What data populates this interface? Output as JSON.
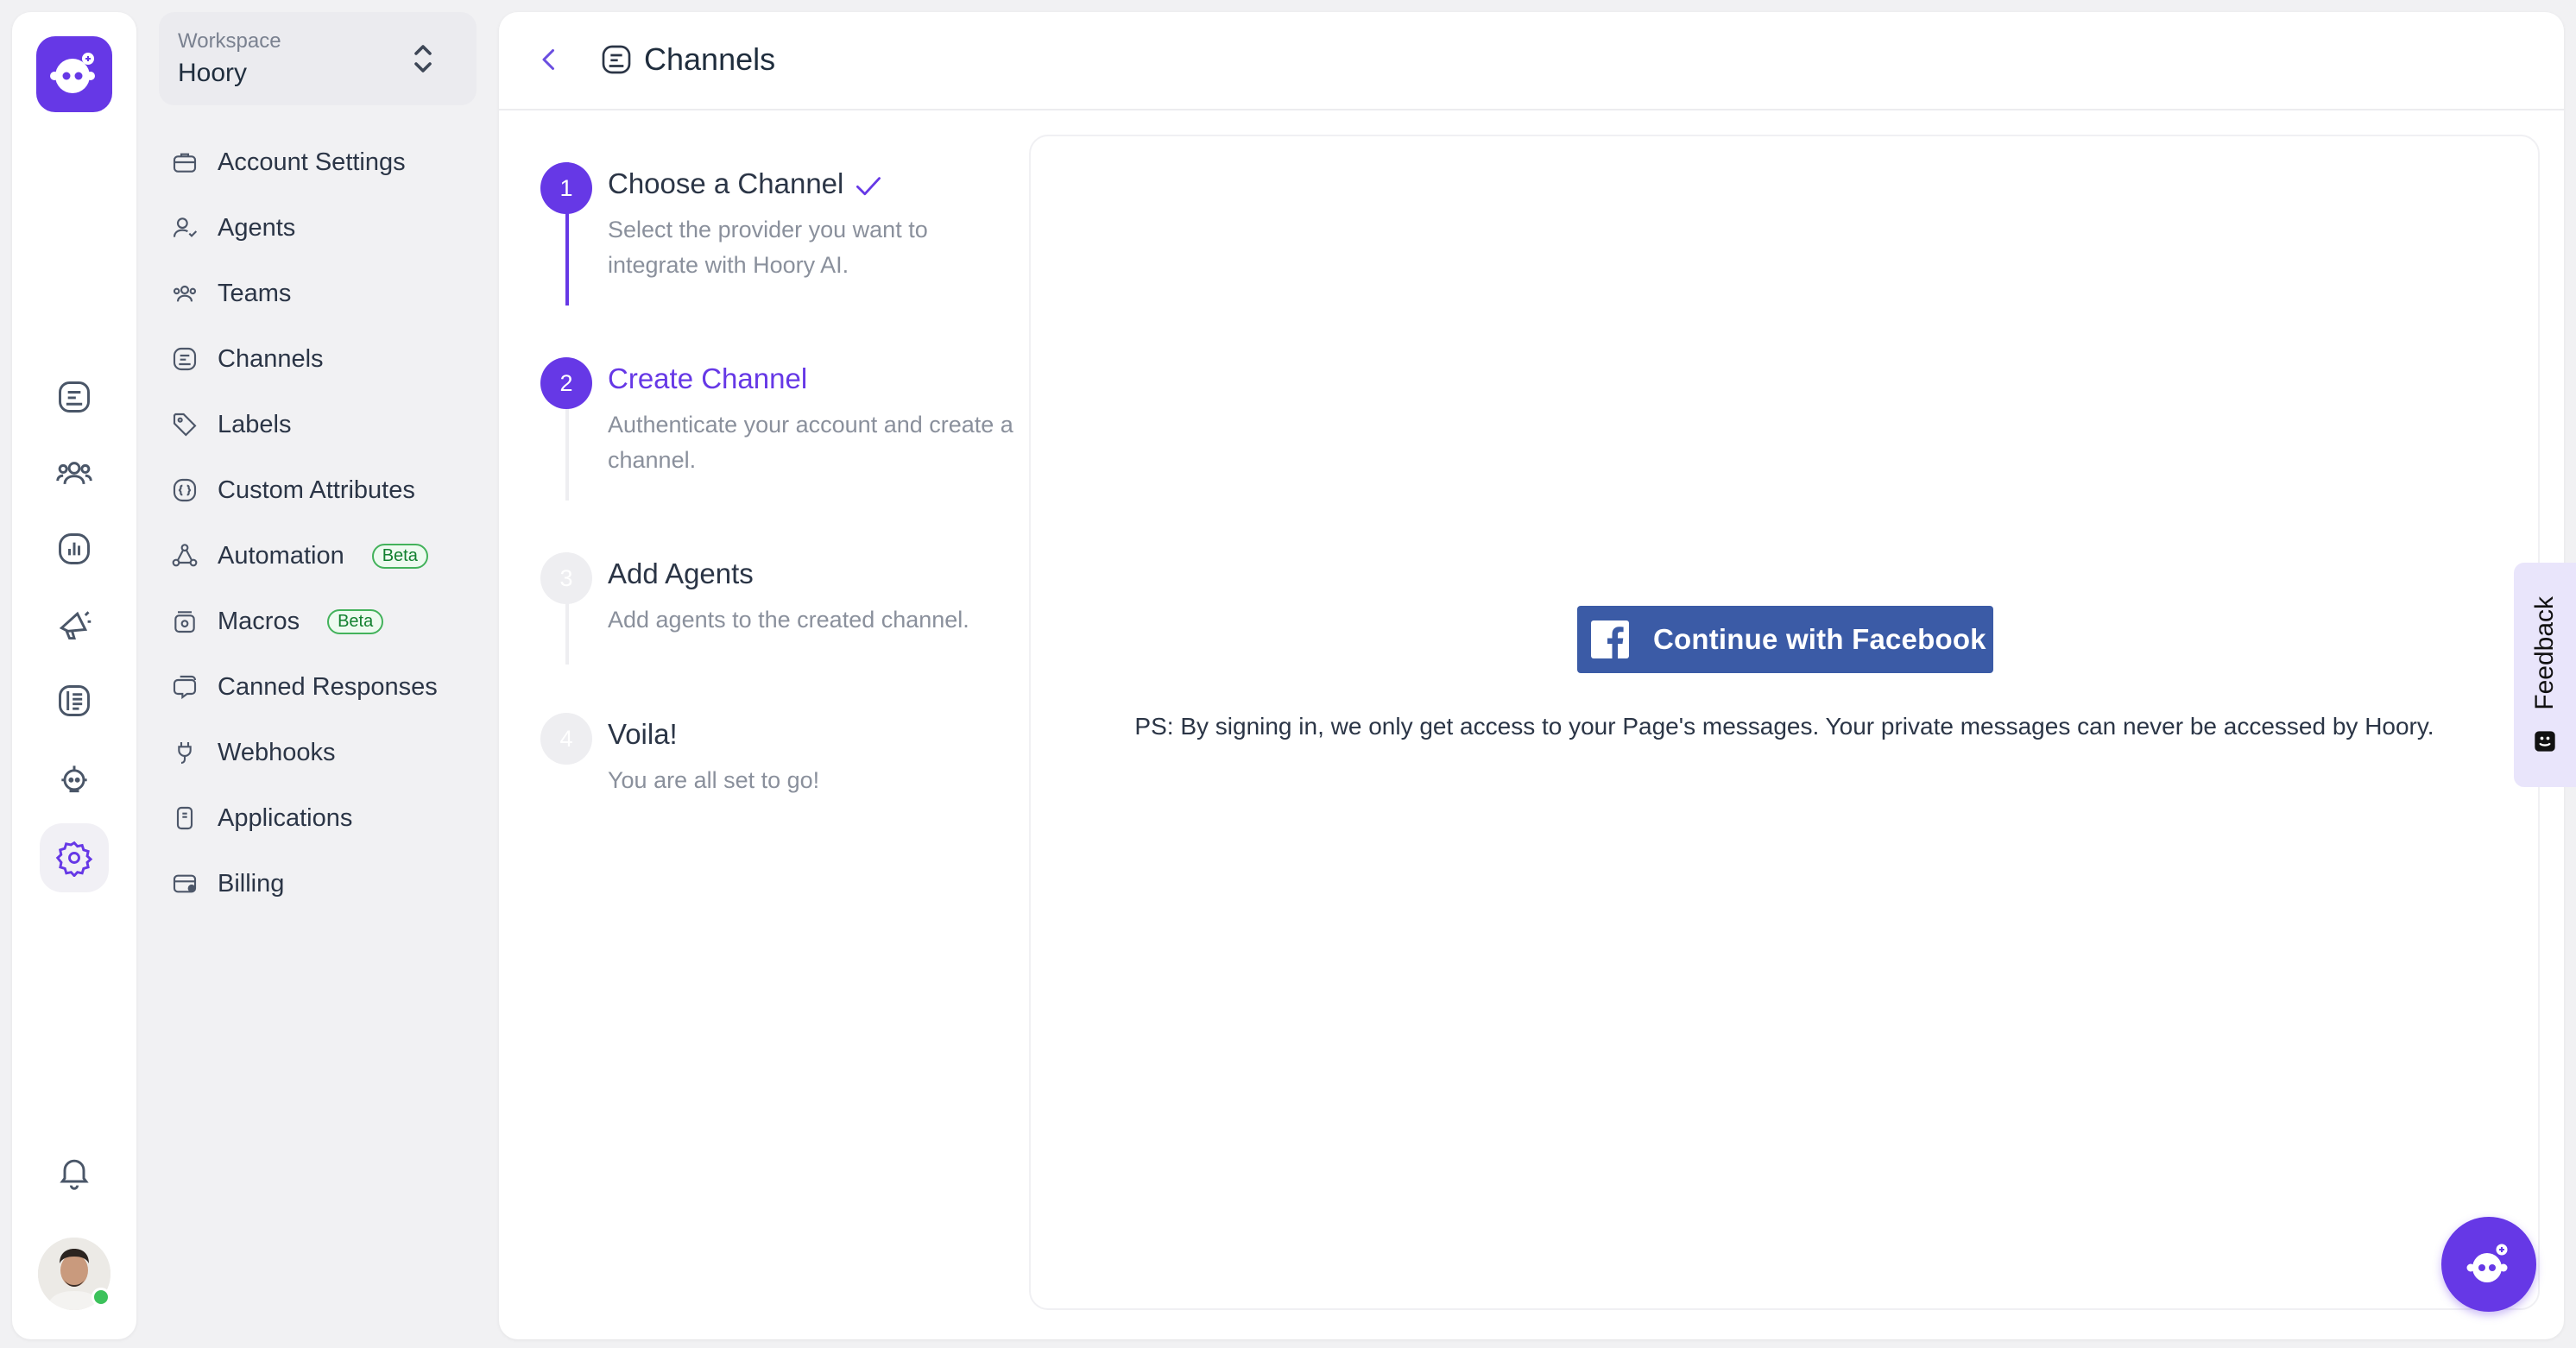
{
  "workspace": {
    "label": "Workspace",
    "name": "Hoory"
  },
  "sidebar": {
    "items": [
      {
        "label": "Account Settings",
        "icon": "briefcase-icon"
      },
      {
        "label": "Agents",
        "icon": "agent-icon"
      },
      {
        "label": "Teams",
        "icon": "teams-icon"
      },
      {
        "label": "Channels",
        "icon": "channels-icon"
      },
      {
        "label": "Labels",
        "icon": "tag-icon"
      },
      {
        "label": "Custom Attributes",
        "icon": "custom-attributes-icon"
      },
      {
        "label": "Automation",
        "icon": "automation-icon",
        "badge": "Beta"
      },
      {
        "label": "Macros",
        "icon": "macros-icon",
        "badge": "Beta"
      },
      {
        "label": "Canned Responses",
        "icon": "canned-responses-icon"
      },
      {
        "label": "Webhooks",
        "icon": "webhook-icon"
      },
      {
        "label": "Applications",
        "icon": "applications-icon"
      },
      {
        "label": "Billing",
        "icon": "billing-icon"
      }
    ]
  },
  "header": {
    "title": "Channels"
  },
  "steps": [
    {
      "number": "1",
      "title": "Choose a Channel",
      "description": "Select the provider you want to integrate with Hoory AI."
    },
    {
      "number": "2",
      "title": "Create Channel",
      "description": "Authenticate your account and create a channel."
    },
    {
      "number": "3",
      "title": "Add Agents",
      "description": "Add agents to the created channel."
    },
    {
      "number": "4",
      "title": "Voila!",
      "description": "You are all set to go!"
    }
  ],
  "content": {
    "facebook_button": "Continue with Facebook",
    "note": "PS: By signing in, we only get access to your Page's messages. Your private messages can never be accessed by Hoory."
  },
  "feedback": {
    "label": "Feedback"
  },
  "colors": {
    "accent": "#6638e6",
    "facebook": "#3b5ba6",
    "online": "#3cc25b"
  }
}
